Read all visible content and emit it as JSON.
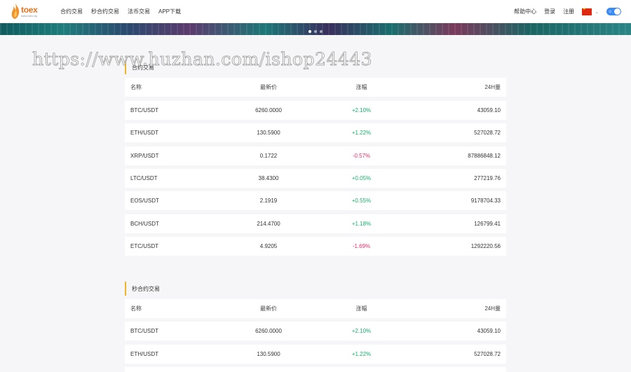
{
  "header": {
    "logo_text": "toex",
    "logo_sub": "www.toex.vip",
    "nav": [
      {
        "label": "合约交易"
      },
      {
        "label": "秒合约交易"
      },
      {
        "label": "法币交易"
      },
      {
        "label": "APP下载"
      }
    ],
    "help": "帮助中心",
    "login": "登录",
    "register": "注册",
    "language_flag": "cn-flag-icon",
    "theme_toggle": "sun-icon"
  },
  "watermark": "https://www.huzhan.com/ishop24443",
  "colors": {
    "up": "#19b36b",
    "down": "#e8326a",
    "accent": "#f0b429",
    "toggle": "#3b8bf5"
  },
  "contract": {
    "title": "合约交易",
    "columns": {
      "name": "名称",
      "price": "最新价",
      "change": "涨幅",
      "volume": "24H量"
    },
    "rows": [
      {
        "name": "BTC/USDT",
        "price": "6260.0000",
        "change": "+2.10%",
        "trend": "up",
        "volume": "43059.10"
      },
      {
        "name": "ETH/USDT",
        "price": "130.5900",
        "change": "+1.22%",
        "trend": "up",
        "volume": "527028.72"
      },
      {
        "name": "XRP/USDT",
        "price": "0.1722",
        "change": "-0.57%",
        "trend": "down",
        "volume": "87886848.12"
      },
      {
        "name": "LTC/USDT",
        "price": "38.4300",
        "change": "+0.05%",
        "trend": "up",
        "volume": "277219.76"
      },
      {
        "name": "EOS/USDT",
        "price": "2.1919",
        "change": "+0.55%",
        "trend": "up",
        "volume": "9178704.33"
      },
      {
        "name": "BCH/USDT",
        "price": "214.4700",
        "change": "+1.18%",
        "trend": "up",
        "volume": "126799.41"
      },
      {
        "name": "ETC/USDT",
        "price": "4.9205",
        "change": "-1.69%",
        "trend": "down",
        "volume": "1292220.56"
      }
    ]
  },
  "seconds_contract": {
    "title": "秒合约交易",
    "columns": {
      "name": "名称",
      "price": "最新价",
      "change": "涨幅",
      "volume": "24H量"
    },
    "rows": [
      {
        "name": "BTC/USDT",
        "price": "6260.0000",
        "change": "+2.10%",
        "trend": "up",
        "volume": "43059.10"
      },
      {
        "name": "ETH/USDT",
        "price": "130.5900",
        "change": "+1.22%",
        "trend": "up",
        "volume": "527028.72"
      }
    ]
  }
}
